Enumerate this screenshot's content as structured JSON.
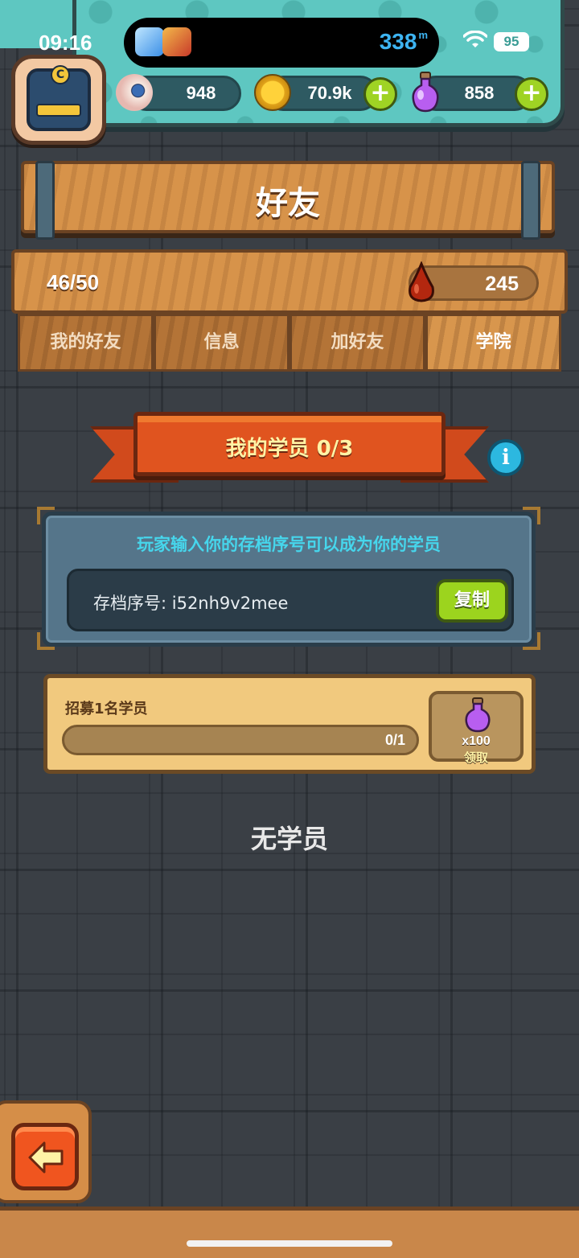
{
  "status_bar": {
    "time": "09:16",
    "distance": "338",
    "distance_unit": "m",
    "battery": "95"
  },
  "resources": {
    "eyeballs": {
      "value": "948",
      "icon": "eyeball-icon"
    },
    "coins": {
      "value": "70.9k",
      "icon": "coin-icon"
    },
    "potions": {
      "value": "858",
      "icon": "potion-icon"
    }
  },
  "header": {
    "title": "好友"
  },
  "friends": {
    "count": "46/50",
    "drops": "245"
  },
  "tabs": [
    {
      "label": "我的好友",
      "active": false
    },
    {
      "label": "信息",
      "active": false
    },
    {
      "label": "加好友",
      "active": false
    },
    {
      "label": "学院",
      "active": true
    }
  ],
  "students": {
    "banner": "我的学员 0/3",
    "invite_hint": "玩家输入你的存档序号可以成为你的学员",
    "save_code": "存档序号: i52nh9v2mee",
    "copy_label": "复制",
    "task": {
      "label": "招募1名学员",
      "progress_text": "0/1",
      "progress": 0
    },
    "reward": {
      "qty": "x100",
      "claim_label": "领取"
    },
    "empty_text": "无学员"
  },
  "colors": {
    "accent_teal": "#5ec7c1",
    "button_green": "#9cd41e",
    "ribbon_red": "#e0541f",
    "hint_cyan": "#46d6ec"
  }
}
